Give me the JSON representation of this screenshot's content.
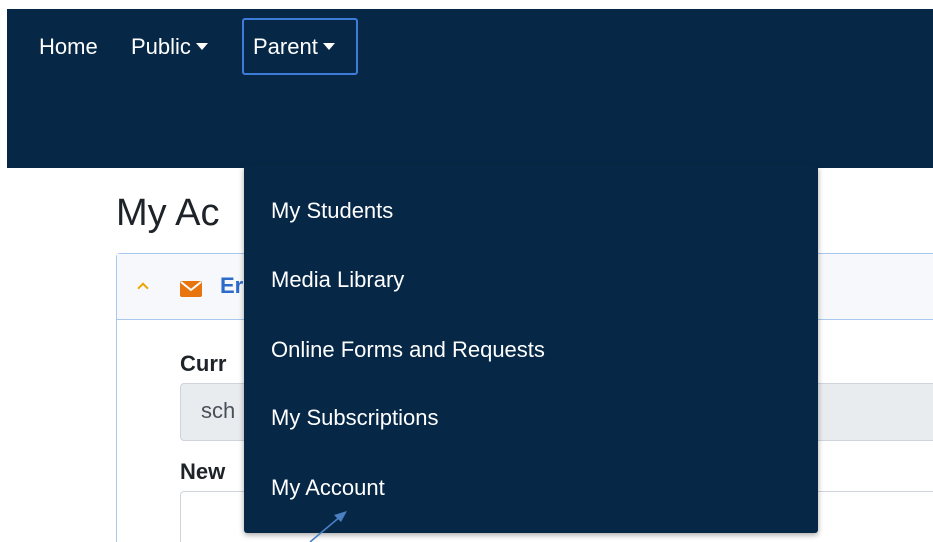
{
  "navbar": {
    "items": [
      {
        "label": "Home"
      },
      {
        "label": "Public"
      },
      {
        "label": "Parent"
      }
    ],
    "background": "#062846"
  },
  "main": {
    "page_title": "My Ac",
    "card": {
      "header_text": "Er",
      "current_label": "Curr",
      "current_value": "sch",
      "new_label": "New"
    }
  },
  "dropdown": {
    "items": [
      {
        "label": "My Students"
      },
      {
        "label": "Media Library"
      },
      {
        "label": "Online Forms and Requests"
      },
      {
        "label": "My Subscriptions"
      },
      {
        "label": "My Account"
      }
    ]
  },
  "colors": {
    "navbar": "#062846",
    "focus_ring": "#3d7bd9",
    "card_border": "#a8c8ee",
    "link": "#2c6bc9",
    "envelope": "#e8740f",
    "chevron": "#f0a500",
    "arrow": "#4a7fc1"
  },
  "icons": {
    "caret": "caret-down-icon",
    "chevron": "chevron-up-icon",
    "envelope": "envelope-icon",
    "annotation": "arrow-annotation"
  }
}
